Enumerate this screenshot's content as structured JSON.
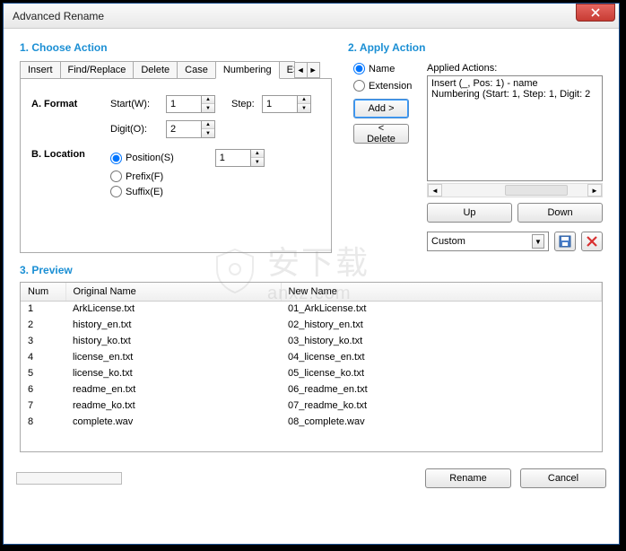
{
  "window": {
    "title": "Advanced Rename"
  },
  "sections": {
    "choose": "1. Choose Action",
    "apply": "2. Apply Action",
    "preview": "3. Preview"
  },
  "tabs": {
    "insert": "Insert",
    "find": "Find/Replace",
    "delete": "Delete",
    "case": "Case",
    "numbering": "Numbering",
    "more": "E>"
  },
  "numbering_panel": {
    "formatLabel": "A. Format",
    "startLabel": "Start(W):",
    "startVal": "1",
    "stepLabel": "Step:",
    "stepVal": "1",
    "digitLabel": "Digit(O):",
    "digitVal": "2",
    "locationLabel": "B. Location",
    "posLabel": "Position(S)",
    "posVal": "1",
    "prefixLabel": "Prefix(F)",
    "suffixLabel": "Suffix(E)"
  },
  "apply_panel": {
    "nameLabel": "Name",
    "extLabel": "Extension",
    "addLabel": "Add >",
    "deleteLabel": "< Delete",
    "appliedTitle": "Applied Actions:",
    "actions": [
      "Insert (_, Pos: 1) - name",
      "Numbering (Start: 1, Step: 1, Digit: 2"
    ],
    "upLabel": "Up",
    "downLabel": "Down",
    "customLabel": "Custom"
  },
  "preview": {
    "cols": {
      "num": "Num",
      "orig": "Original Name",
      "newn": "New Name"
    },
    "rows": [
      {
        "n": "1",
        "o": "ArkLicense.txt",
        "nn": "01_ArkLicense.txt"
      },
      {
        "n": "2",
        "o": "history_en.txt",
        "nn": "02_history_en.txt"
      },
      {
        "n": "3",
        "o": "history_ko.txt",
        "nn": "03_history_ko.txt"
      },
      {
        "n": "4",
        "o": "license_en.txt",
        "nn": "04_license_en.txt"
      },
      {
        "n": "5",
        "o": "license_ko.txt",
        "nn": "05_license_ko.txt"
      },
      {
        "n": "6",
        "o": "readme_en.txt",
        "nn": "06_readme_en.txt"
      },
      {
        "n": "7",
        "o": "readme_ko.txt",
        "nn": "07_readme_ko.txt"
      },
      {
        "n": "8",
        "o": "complete.wav",
        "nn": "08_complete.wav"
      }
    ]
  },
  "footer": {
    "rename": "Rename",
    "cancel": "Cancel"
  },
  "watermark": {
    "cn": "安下载",
    "en": "anxz.com"
  }
}
